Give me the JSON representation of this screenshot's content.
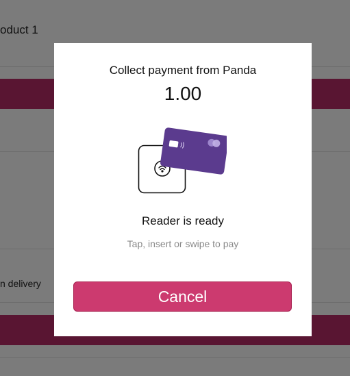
{
  "background": {
    "product_label": "oduct 1",
    "delivery_label": "n delivery"
  },
  "modal": {
    "title": "Collect payment from Panda",
    "amount": "1.00",
    "status": "Reader is ready",
    "hint": "Tap, insert or swipe to pay",
    "cancel_label": "Cancel"
  },
  "colors": {
    "accent": "#cc3a6f",
    "card": "#5b3b8e",
    "bar": "#b22a64"
  },
  "icons": [
    "card-reader-icon",
    "payment-card-icon",
    "contactless-icon"
  ]
}
